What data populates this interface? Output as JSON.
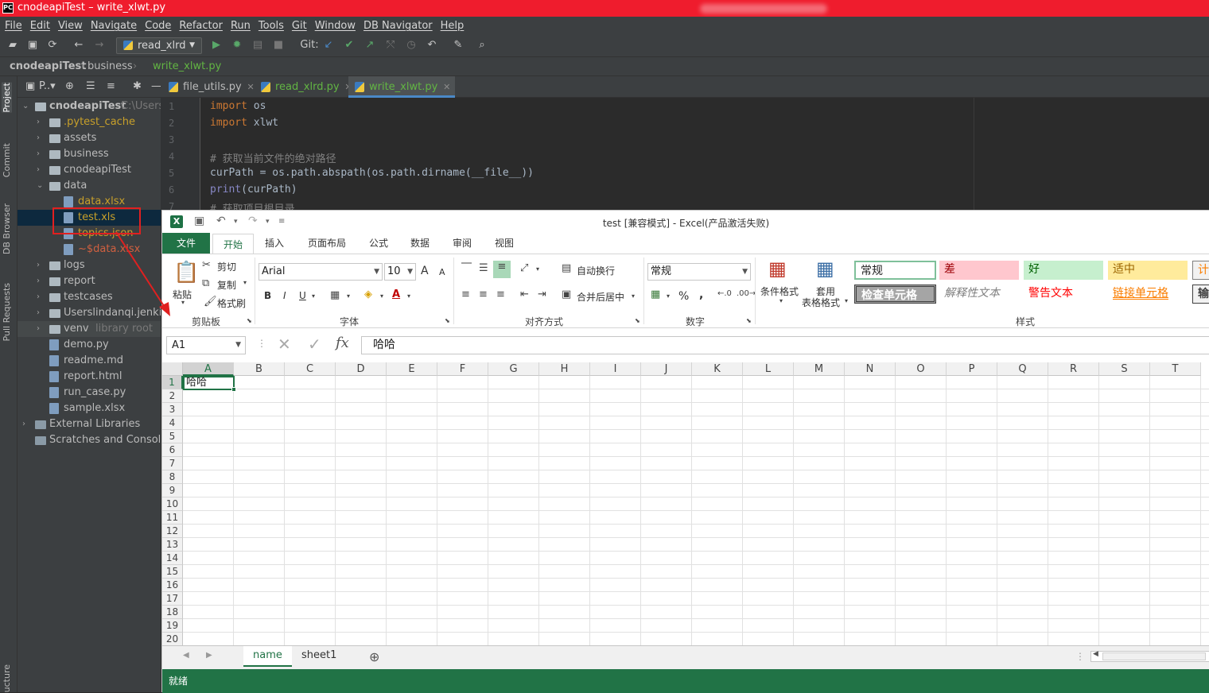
{
  "ide": {
    "window_title": "cnodeapiTest – write_xlwt.py",
    "logo": "PC",
    "menu": [
      "File",
      "Edit",
      "View",
      "Navigate",
      "Code",
      "Refactor",
      "Run",
      "Tools",
      "Git",
      "Window",
      "DB Navigator",
      "Help"
    ],
    "run_config": "read_xlrd",
    "git_label": "Git:",
    "breadcrumb": [
      "cnodeapiTest",
      "business",
      "write_xlwt.py"
    ],
    "tool_tabs": [
      "Project",
      "Commit",
      "DB Browser",
      "Pull Requests",
      "ucture"
    ],
    "project_header": "P..▾",
    "project_tree": [
      {
        "label": "cnodeapiTest",
        "suffix": "C:\\Users",
        "type": "folder",
        "open": true
      },
      {
        "label": ".pytest_cache",
        "type": "folder"
      },
      {
        "label": "assets",
        "type": "folder"
      },
      {
        "label": "business",
        "type": "folder"
      },
      {
        "label": "cnodeapiTest",
        "type": "folder"
      },
      {
        "label": "data",
        "type": "folder",
        "open": true
      },
      {
        "label": "data.xlsx",
        "type": "file"
      },
      {
        "label": "test.xls",
        "type": "file"
      },
      {
        "label": "topics.json",
        "type": "file"
      },
      {
        "label": "~$data.xlsx",
        "type": "file"
      },
      {
        "label": "logs",
        "type": "folder"
      },
      {
        "label": "report",
        "type": "folder"
      },
      {
        "label": "testcases",
        "type": "folder"
      },
      {
        "label": "Userslindanqi.jenkins",
        "type": "folder"
      },
      {
        "label": "venv",
        "suffix": "library root",
        "type": "folder"
      },
      {
        "label": "demo.py",
        "type": "file"
      },
      {
        "label": "readme.md",
        "type": "file"
      },
      {
        "label": "report.html",
        "type": "file"
      },
      {
        "label": "run_case.py",
        "type": "file"
      },
      {
        "label": "sample.xlsx",
        "type": "file"
      },
      {
        "label": "External Libraries",
        "type": "lib"
      },
      {
        "label": "Scratches and Consoles",
        "type": "lib"
      }
    ],
    "editor_tabs": [
      "file_utils.py",
      "read_xlrd.py",
      "write_xlwt.py"
    ],
    "active_tab": "write_xlwt.py",
    "code_lines": [
      {
        "n": "1",
        "kw": "import",
        "rest": " os"
      },
      {
        "n": "2",
        "kw": "import",
        "rest": " xlwt"
      },
      {
        "n": "3",
        "kw": "",
        "rest": ""
      },
      {
        "n": "4",
        "comment": "# 获取当前文件的绝对路径"
      },
      {
        "n": "5",
        "kw": "",
        "rest": "curPath = os.path.abspath(os.path.dirname(__file__))"
      },
      {
        "n": "6",
        "builtin": "print",
        "rest": "(curPath)"
      },
      {
        "n": "7",
        "comment": "# 获取项目根目录"
      }
    ]
  },
  "excel": {
    "icon": "X",
    "title": "test  [兼容模式] - Excel(产品激活失败)",
    "tabs": [
      "文件",
      "开始",
      "插入",
      "页面布局",
      "公式",
      "数据",
      "审阅",
      "视图"
    ],
    "clipboard": {
      "paste": "粘贴",
      "cut": "剪切",
      "copy": "复制",
      "format_painter": "格式刷",
      "label": "剪贴板"
    },
    "font": {
      "name": "Arial",
      "size": "10",
      "label": "字体",
      "bold": "B",
      "italic": "I",
      "underline": "U",
      "grow": "A",
      "shrink": "A"
    },
    "alignment": {
      "wrap": "自动换行",
      "merge": "合并后居中",
      "label": "对齐方式"
    },
    "number": {
      "format": "常规",
      "percent": "%",
      "comma": ",",
      "label": "数字"
    },
    "styles_group": {
      "conditional": "条件格式",
      "table1": "套用",
      "table2": "表格格式",
      "label": "样式"
    },
    "styles": [
      "常规",
      "差",
      "好",
      "适中",
      "计",
      "检查单元格",
      "解释性文本",
      "警告文本",
      "链接单元格",
      "输"
    ],
    "name_box": "A1",
    "fx": "fx",
    "formula_value": "哈哈",
    "columns": [
      "A",
      "B",
      "C",
      "D",
      "E",
      "F",
      "G",
      "H",
      "I",
      "J",
      "K",
      "L",
      "M",
      "N",
      "O",
      "P",
      "Q",
      "R",
      "S",
      "T"
    ],
    "rows": [
      "1",
      "2",
      "3",
      "4",
      "5",
      "6",
      "7",
      "8",
      "9",
      "10",
      "11",
      "12",
      "13",
      "14",
      "15",
      "16",
      "17",
      "18",
      "19",
      "20"
    ],
    "cell_a1": "哈哈",
    "sheets": [
      "name",
      "sheet1"
    ],
    "active_sheet": "name",
    "status": "就绪"
  },
  "colors": {
    "excel_green": "#217346",
    "ide_bg": "#2b2b2b",
    "annotation": "#e02020"
  }
}
